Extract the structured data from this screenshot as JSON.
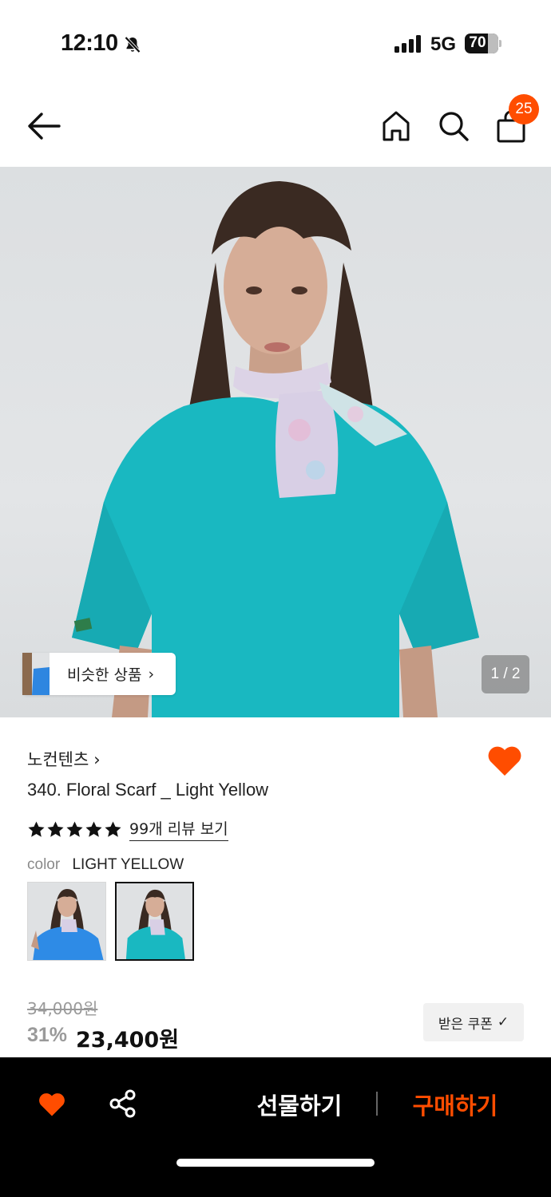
{
  "status_bar": {
    "time": "12:10",
    "network": "5G",
    "battery": "70",
    "battery_level": 0.7
  },
  "nav": {
    "cart_count": "25"
  },
  "gallery": {
    "similar_label": "비슷한 상품",
    "similar_chevron": "›",
    "counter": "1 / 2"
  },
  "product": {
    "brand": "노컨텐츠",
    "brand_chevron": "›",
    "title": "340. Floral Scarf _ Light Yellow",
    "rating": 5,
    "review_link": "99개 리뷰 보기",
    "color_label": "color",
    "color_value": "LIGHT YELLOW",
    "original_price": "34,000원",
    "discount": "31%",
    "sale_price": "23,400원",
    "coupon_label": "받은 쿠폰",
    "coupon_check": "✓"
  },
  "bottom_bar": {
    "gift_label": "선물하기",
    "buy_label": "구매하기"
  },
  "colors": {
    "accent": "#ff4d00",
    "text": "#111111",
    "muted": "#9a9a9a",
    "bar": "#000000"
  },
  "icons": {
    "back": "arrow-left-icon",
    "home": "home-icon",
    "search": "search-icon",
    "bag": "shopping-bag-icon",
    "wish": "heart-icon",
    "share": "share-icon",
    "star": "star-icon"
  }
}
